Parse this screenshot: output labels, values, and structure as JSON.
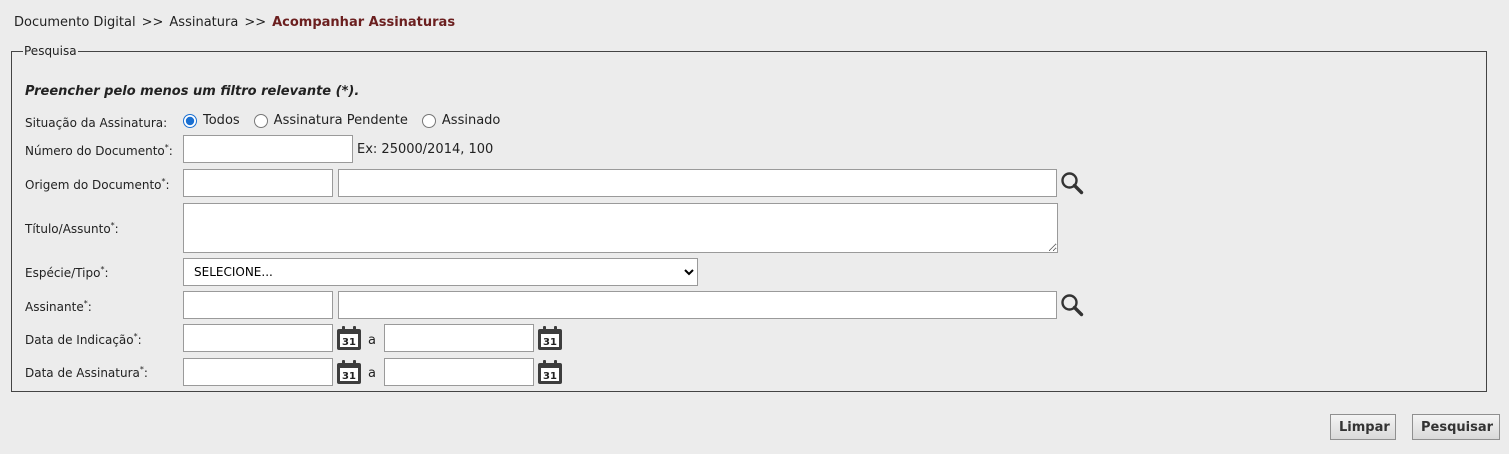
{
  "breadcrumb": {
    "items": [
      "Documento Digital",
      "Assinatura"
    ],
    "separator": ">>",
    "current": "Acompanhar Assinaturas"
  },
  "search": {
    "legend": "Pesquisa",
    "hint": "Preencher pelo menos um filtro relevante (*).",
    "required_marker": "*",
    "situacao": {
      "label": "Situação da Assinatura:",
      "options": [
        "Todos",
        "Assinatura Pendente",
        "Assinado"
      ],
      "selected": "Todos"
    },
    "numero": {
      "label": "Número do Documento",
      "value": "",
      "example": "Ex: 25000/2014, 100"
    },
    "origem": {
      "label": "Origem do Documento",
      "code_value": "",
      "name_value": "",
      "icon": "magnifier-icon"
    },
    "titulo": {
      "label": "Título/Assunto",
      "value": ""
    },
    "especie": {
      "label": "Espécie/Tipo",
      "selected": "SELECIONE..."
    },
    "assinante": {
      "label": "Assinante",
      "code_value": "",
      "name_value": "",
      "icon": "magnifier-icon"
    },
    "data_indicacao": {
      "label": "Data de Indicação",
      "from": "",
      "to": "",
      "range_sep": "a",
      "icon": "calendar-icon",
      "calendar_day": "31"
    },
    "data_assinatura": {
      "label": "Data de Assinatura",
      "from": "",
      "to": "",
      "range_sep": "a",
      "icon": "calendar-icon",
      "calendar_day": "31"
    }
  },
  "buttons": {
    "clear": "Limpar",
    "search": "Pesquisar"
  },
  "colors": {
    "breadcrumb_current": "#6b1f1f",
    "background": "#ececec",
    "radio_accent": "#1a6fd1"
  }
}
